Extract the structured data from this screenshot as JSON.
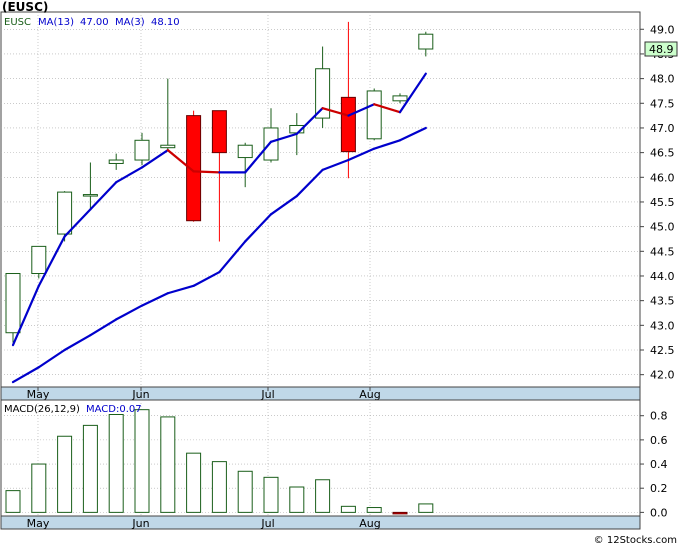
{
  "header": {
    "ticker_title": "(EUSC)",
    "watermark": "© 12Stocks.com",
    "price_legend": {
      "symbol": "EUSC",
      "ma13_label": "MA(13)",
      "ma13_value": "47.00",
      "ma3_label": "MA(3)",
      "ma3_value": "48.10"
    },
    "macd_legend": {
      "label": "MACD(26,12,9)",
      "value_label": "MACD:0.07"
    },
    "last_price_label": "48.9"
  },
  "colors": {
    "up_candle": "#1a5e1a",
    "down_candle": "#ff0000",
    "ma_line": "#0000cc",
    "ma3_down_segment": "#cc0000",
    "grid": "#aaaaaa",
    "frame": "#444444",
    "axis_band": "#c0d8e8",
    "last_price_box": "#ccffcc"
  },
  "chart_data": [
    {
      "type": "candlestick",
      "title": "",
      "x_tick_labels": [
        "May",
        "Jun",
        "Jul",
        "Aug"
      ],
      "y_tick_labels": [
        "42.0",
        "42.5",
        "43.0",
        "43.5",
        "44.0",
        "44.5",
        "45.0",
        "45.5",
        "46.0",
        "46.5",
        "47.0",
        "47.5",
        "48.0",
        "48.5",
        "49.0"
      ],
      "ylim": [
        41.75,
        49.35
      ],
      "grid": true,
      "candles": [
        {
          "o": 42.85,
          "h": 44.05,
          "l": 42.65,
          "c": 44.05,
          "dir": "up"
        },
        {
          "o": 44.05,
          "h": 44.6,
          "l": 43.95,
          "c": 44.6,
          "dir": "up"
        },
        {
          "o": 44.85,
          "h": 45.72,
          "l": 44.7,
          "c": 45.7,
          "dir": "up"
        },
        {
          "o": 45.62,
          "h": 46.3,
          "l": 45.35,
          "c": 45.65,
          "dir": "up"
        },
        {
          "o": 46.28,
          "h": 46.48,
          "l": 46.15,
          "c": 46.35,
          "dir": "up"
        },
        {
          "o": 46.35,
          "h": 46.9,
          "l": 46.25,
          "c": 46.75,
          "dir": "up"
        },
        {
          "o": 46.6,
          "h": 48.0,
          "l": 46.55,
          "c": 46.65,
          "dir": "up"
        },
        {
          "o": 47.25,
          "h": 47.35,
          "l": 45.1,
          "c": 45.12,
          "dir": "down"
        },
        {
          "o": 47.35,
          "h": 47.35,
          "l": 44.7,
          "c": 46.5,
          "dir": "down"
        },
        {
          "o": 46.4,
          "h": 46.7,
          "l": 45.8,
          "c": 46.65,
          "dir": "up"
        },
        {
          "o": 46.35,
          "h": 47.4,
          "l": 46.3,
          "c": 47.0,
          "dir": "up"
        },
        {
          "o": 46.9,
          "h": 47.3,
          "l": 46.45,
          "c": 47.05,
          "dir": "up"
        },
        {
          "o": 47.2,
          "h": 48.65,
          "l": 47.0,
          "c": 48.2,
          "dir": "up"
        },
        {
          "o": 47.62,
          "h": 49.15,
          "l": 45.98,
          "c": 46.52,
          "dir": "down"
        },
        {
          "o": 46.78,
          "h": 47.8,
          "l": 46.75,
          "c": 47.75,
          "dir": "up"
        },
        {
          "o": 47.55,
          "h": 47.7,
          "l": 47.5,
          "c": 47.65,
          "dir": "up"
        },
        {
          "o": 48.6,
          "h": 48.95,
          "l": 48.45,
          "c": 48.9,
          "dir": "up"
        }
      ],
      "series": [
        {
          "name": "MA(13)",
          "values": [
            41.85,
            42.15,
            42.5,
            42.8,
            43.12,
            43.4,
            43.65,
            43.8,
            44.08,
            44.7,
            45.25,
            45.62,
            46.15,
            46.35,
            46.58,
            46.75,
            47.0
          ]
        },
        {
          "name": "MA(3)",
          "values": [
            42.6,
            43.8,
            44.8,
            45.35,
            45.9,
            46.2,
            46.55,
            46.12,
            46.1,
            46.1,
            46.72,
            46.88,
            47.4,
            47.25,
            47.48,
            47.32,
            48.1
          ]
        }
      ]
    },
    {
      "type": "bar",
      "title": "",
      "series_name": "MACD(26,12,9)",
      "x_tick_labels": [
        "May",
        "Jun",
        "Jul",
        "Aug"
      ],
      "y_tick_labels": [
        "0.0",
        "0.2",
        "0.4",
        "0.6",
        "0.8"
      ],
      "ylim": [
        -0.03,
        0.93
      ],
      "grid": true,
      "values": [
        0.18,
        0.4,
        0.63,
        0.72,
        0.81,
        0.85,
        0.79,
        0.49,
        0.42,
        0.34,
        0.29,
        0.21,
        0.27,
        0.05,
        0.04,
        -0.01,
        0.07
      ]
    }
  ]
}
